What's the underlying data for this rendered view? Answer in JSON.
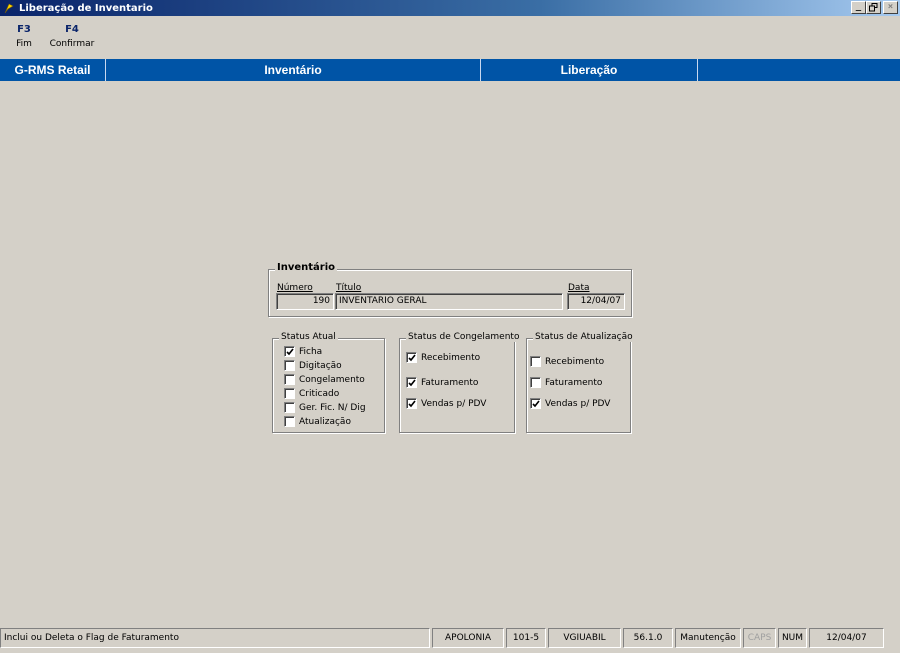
{
  "window": {
    "title": "Liberação de Inventario",
    "buttons": [
      "_",
      "🗗",
      "×"
    ]
  },
  "toolbar": {
    "keys": [
      {
        "key": "F3",
        "label": "Fim"
      },
      {
        "key": "F4",
        "label": "Confirmar"
      }
    ]
  },
  "header": {
    "app": "G-RMS Retail",
    "module": "Inventário",
    "screen": "Liberação"
  },
  "inventario": {
    "group_title": "Inventário",
    "numero_label": "Número",
    "numero_value": "190",
    "titulo_label": "Título",
    "titulo_value": "INVENTARIO GERAL",
    "data_label": "Data",
    "data_value": "12/04/07"
  },
  "status_atual": {
    "title": "Status Atual",
    "items": [
      {
        "label": "Ficha",
        "checked": true
      },
      {
        "label": "Digitação",
        "checked": false
      },
      {
        "label": "Congelamento",
        "checked": false
      },
      {
        "label": "Criticado",
        "checked": false
      },
      {
        "label": "Ger. Fic. N/ Dig",
        "checked": false
      },
      {
        "label": "Atualização",
        "checked": false
      }
    ]
  },
  "status_congelamento": {
    "title": "Status de Congelamento",
    "items": [
      {
        "label": "Recebimento",
        "checked": true
      },
      {
        "label": "Faturamento",
        "checked": true
      },
      {
        "label": "Vendas p/ PDV",
        "checked": true
      }
    ]
  },
  "status_atualizacao": {
    "title": "Status de Atualização",
    "items": [
      {
        "label": "Recebimento",
        "checked": false
      },
      {
        "label": "Faturamento",
        "checked": false
      },
      {
        "label": "Vendas p/ PDV",
        "checked": true
      }
    ]
  },
  "statusbar": {
    "message": "Inclui ou Deleta o Flag de Faturamento",
    "server": "APOLONIA",
    "store": "101-5",
    "user": "VGIUABIL",
    "version": "56.1.0",
    "mode": "Manutenção",
    "caps": "CAPS",
    "num": "NUM",
    "date": "12/04/07"
  },
  "colors": {
    "header_blue": "#0054a6",
    "face": "#d4d0c8",
    "title_gradient_start": "#0a246a"
  }
}
